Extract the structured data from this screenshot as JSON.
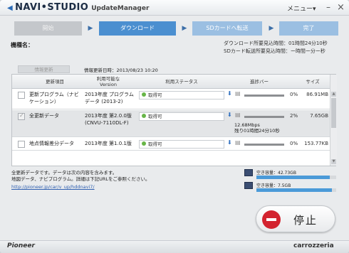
{
  "titlebar": {
    "brand": "NAVI•STUDIO",
    "app": "UpdateManager",
    "menu_label": "メニュー▾",
    "minimize": "–",
    "close": "×"
  },
  "steps": [
    {
      "label": "開始"
    },
    {
      "label": "ダウンロード"
    },
    {
      "label": "SDカードへ転送"
    },
    {
      "label": "完了"
    }
  ],
  "device": {
    "label": "機種名："
  },
  "times": {
    "download_label": "ダウンロード所要見込時間",
    "download_value": "：01時間24分10秒",
    "transfer_label": "SDカード転送所要見込時間",
    "transfer_value": "：ー時間ー分ー秒"
  },
  "info_button": "情報更新",
  "updated_text": "情報更新日時：2013/08/23 10:20",
  "table": {
    "headers": {
      "item": "更新項目",
      "version": "利用可能な\nVersion",
      "status": "利用ステータス",
      "progress": "進捗バー",
      "size": "サイズ"
    },
    "rows": [
      {
        "name": "更新プログラム（ナビケーション）",
        "version": "2013年度 プログラムデータ (2013-2)",
        "status": "取得可",
        "progress": "0%",
        "size": "86.91MB"
      },
      {
        "name": "全更新データ",
        "version": "2013年度 第2.0.0版 (CNVU-7110DL-F)",
        "status": "取得可",
        "progress": "2%",
        "speed": "12.68Mbps",
        "remaining": "残り01時間24分10秒",
        "size": "7.65GB"
      },
      {
        "name": "地点情報差分データ",
        "version": "2013年度 第1.0.1版",
        "status": "取得可",
        "progress": "0%",
        "size": "153.77KB"
      }
    ]
  },
  "note": {
    "line1": "全更新データです。データは次の内容を含みます。",
    "line2": "地図データ、ナビプログラム。詳細は下記URLをご参照ください。",
    "link": "http://pioneer.jp/car/v_up/hddnavi7/"
  },
  "storage": [
    {
      "label": "空き容量：42.73GB",
      "fill": 0.92
    },
    {
      "label": "空き容量：7.5GB",
      "fill": 0.95
    }
  ],
  "stop_button": "停止",
  "footer": {
    "left": "Pioneer",
    "right": "carrozzeria"
  }
}
